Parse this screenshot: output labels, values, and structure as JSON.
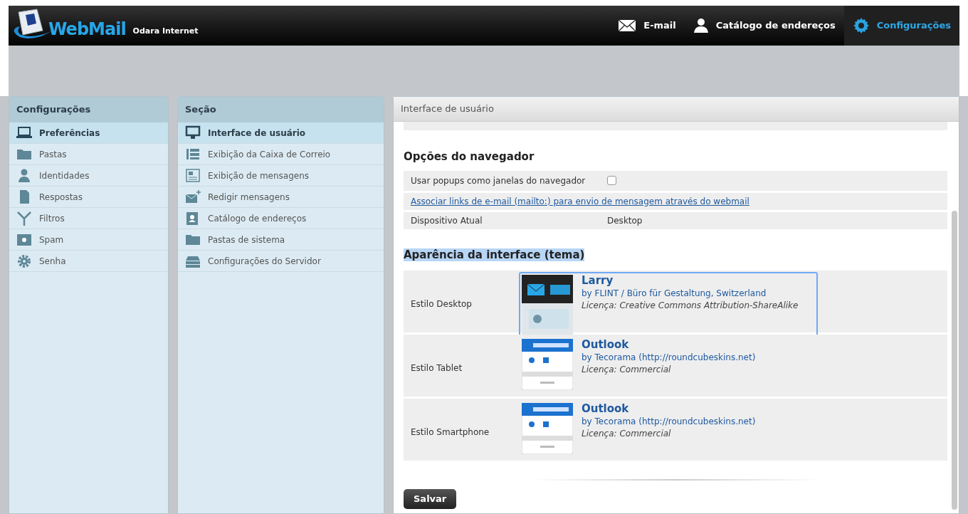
{
  "header": {
    "logo_text": "WebMail",
    "logo_subtitle": "Odara Internet",
    "nav": [
      {
        "kind": "mail",
        "label": "E-mail",
        "selected": false
      },
      {
        "kind": "contacts",
        "label": "Catálogo de endereços",
        "selected": false
      },
      {
        "kind": "settings",
        "label": "Configurações",
        "selected": true
      }
    ]
  },
  "settings_panel": {
    "title": "Configurações",
    "items": [
      {
        "kind": "laptop",
        "label": "Preferências",
        "selected": true
      },
      {
        "kind": "folder",
        "label": "Pastas",
        "selected": false
      },
      {
        "kind": "person",
        "label": "Identidades",
        "selected": false
      },
      {
        "kind": "document",
        "label": "Respostas",
        "selected": false
      },
      {
        "kind": "filter",
        "label": "Filtros",
        "selected": false
      },
      {
        "kind": "spam",
        "label": "Spam",
        "selected": false
      },
      {
        "kind": "gear",
        "label": "Senha",
        "selected": false
      }
    ]
  },
  "section_panel": {
    "title": "Seção",
    "items": [
      {
        "kind": "monitor",
        "label": "Interface de usuário",
        "selected": true
      },
      {
        "kind": "list",
        "label": "Exibição da Caixa de Correio",
        "selected": false
      },
      {
        "kind": "message",
        "label": "Exibição de mensagens",
        "selected": false
      },
      {
        "kind": "compose",
        "label": "Redigir mensagens",
        "selected": false
      },
      {
        "kind": "addressbook",
        "label": "Catálogo de endereços",
        "selected": false
      },
      {
        "kind": "folder",
        "label": "Pastas de sistema",
        "selected": false
      },
      {
        "kind": "server",
        "label": "Configurações do Servidor",
        "selected": false
      }
    ]
  },
  "content": {
    "title": "Interface de usuário",
    "browser_options": {
      "heading": "Opções do navegador",
      "rows": [
        {
          "kind": "checkbox",
          "label": "Usar popups como janelas do navegador",
          "checked": false
        },
        {
          "kind": "link",
          "label": "Associar links de e-mail (mailto:) para envio de mensagem através do webmail"
        },
        {
          "kind": "text",
          "label": "Dispositivo Atual",
          "value": "Desktop"
        }
      ]
    },
    "appearance": {
      "heading": "Aparência da interface (tema)",
      "rows": [
        {
          "label": "Estilo Desktop",
          "kind": "dark",
          "name": "Larry",
          "author": "by FLINT / Büro für Gestaltung, Switzerland",
          "license": "Licença: Creative Commons Attribution-ShareAlike",
          "selected": true
        },
        {
          "label": "Estilo Tablet",
          "kind": "light",
          "name": "Outlook",
          "author": "by Tecorama (http://roundcubeskins.net)",
          "license": "Licença: Commercial",
          "selected": false
        },
        {
          "label": "Estilo Smartphone",
          "kind": "light",
          "name": "Outlook",
          "author": "by Tecorama (http://roundcubeskins.net)",
          "license": "Licença: Commercial",
          "selected": false
        }
      ]
    },
    "save_button": "Salvar"
  }
}
